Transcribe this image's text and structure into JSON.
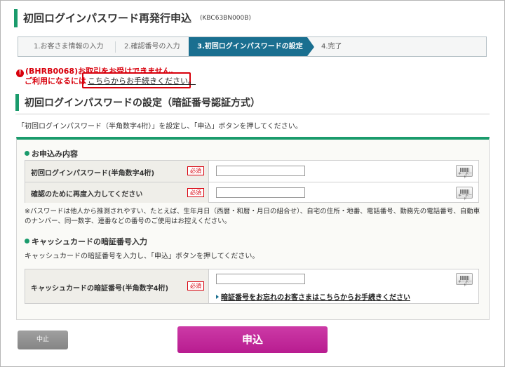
{
  "header": {
    "title": "初回ログインパスワード再発行申込",
    "code": "(KBC63BN000B)"
  },
  "steps": [
    {
      "label": "1.お客さま情報の入力",
      "state": "done"
    },
    {
      "label": "2.確認番号の入力",
      "state": "done"
    },
    {
      "label": "3.初回ログインパスワードの設定",
      "state": "active"
    },
    {
      "label": "4.完了",
      "state": "todo"
    }
  ],
  "error": {
    "icon": "exclamation-icon",
    "line1": "(BHRB0068)お取引をお受けできません。",
    "line2": "ご利用になるには",
    "link": "こちらからお手続きください。",
    "color": "#d8000c"
  },
  "section": {
    "title": "初回ログインパスワードの設定（暗証番号認証方式）",
    "description": "「初回ログインパスワード（半角数字4桁）」を設定し、「申込」ボタンを押してください。"
  },
  "application": {
    "heading": "お申込み内容",
    "rows": [
      {
        "label": "初回ログインパスワード(半角数字4桁)",
        "required": "必須",
        "value": ""
      },
      {
        "label": "確認のために再度入力してください",
        "required": "必須",
        "value": ""
      }
    ],
    "note": "※パスワードは他人から推測されやすい、たとえば、生年月日（西暦・和暦・月日の組合せ）、自宅の住所・地番、電話番号、勤務先の電話番号、自動車のナンバー、同一数字、連番などの番号のご使用はお控えください。"
  },
  "cash_card": {
    "heading": "キャッシュカードの暗証番号入力",
    "description": "キャッシュカードの暗証番号を入力し、「申込」ボタンを押してください。",
    "label": "キャッシュカードの暗証番号(半角数字4桁)",
    "required": "必須",
    "value": "",
    "forgot_link": "暗証番号をお忘れのお客さまはこちらからお手続きください"
  },
  "keyboard_label": "キーボード",
  "buttons": {
    "cancel": "中止",
    "apply": "申込"
  },
  "colors": {
    "accent": "#1a9b6c",
    "step_active": "#1a6f90",
    "apply_button": "#b81c90"
  }
}
